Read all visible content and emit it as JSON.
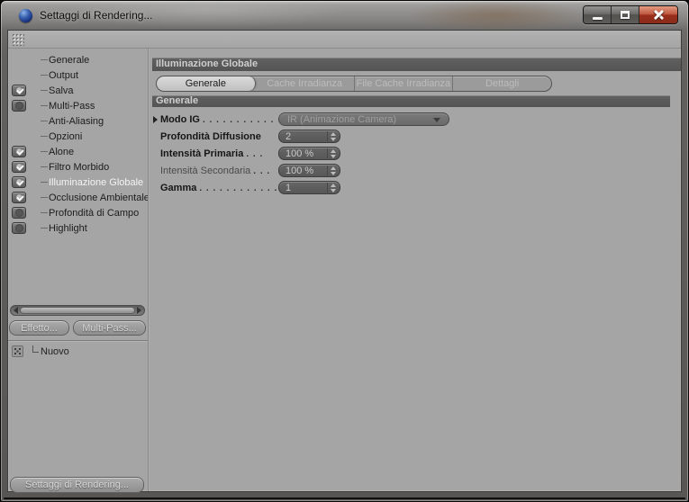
{
  "window": {
    "title": "Settaggi di Rendering...",
    "icons": {
      "app": "c4d-sphere-icon",
      "minimize": "minimize-icon",
      "maximize": "maximize-icon",
      "close": "close-icon"
    }
  },
  "toolbar": {
    "grip": "grip-dots-icon"
  },
  "sidebar": {
    "items": [
      {
        "label": "Generale",
        "enabled": null,
        "selected": false
      },
      {
        "label": "Output",
        "enabled": null,
        "selected": false
      },
      {
        "label": "Salva",
        "enabled": true,
        "selected": false
      },
      {
        "label": "Multi-Pass",
        "enabled": false,
        "selected": false
      },
      {
        "label": "Anti-Aliasing",
        "enabled": null,
        "selected": false
      },
      {
        "label": "Opzioni",
        "enabled": null,
        "selected": false
      },
      {
        "label": "Alone",
        "enabled": true,
        "selected": false
      },
      {
        "label": "Filtro Morbido",
        "enabled": true,
        "selected": false
      },
      {
        "label": "Illuminazione Globale",
        "enabled": true,
        "selected": true
      },
      {
        "label": "Occlusione Ambientale",
        "enabled": true,
        "selected": false
      },
      {
        "label": "Profondità di Campo",
        "enabled": false,
        "selected": false
      },
      {
        "label": "Highlight",
        "enabled": false,
        "selected": false
      }
    ],
    "effect_button": "Effetto...",
    "multipass_button": "Multi-Pass...",
    "presets": [
      {
        "label": "Nuovo"
      }
    ],
    "render_settings_button": "Settaggi di Rendering..."
  },
  "main": {
    "header": "Illuminazione Globale",
    "tabs": [
      {
        "label": "Generale",
        "active": true
      },
      {
        "label": "Cache Irradianza",
        "active": false
      },
      {
        "label": "File Cache Irradianza",
        "active": false
      },
      {
        "label": "Dettagli",
        "active": false
      }
    ],
    "section": "Generale",
    "fields": [
      {
        "label": "Modo IG",
        "dots": ". . . . . . . . . . .",
        "value": "IR (Animazione Camera)",
        "dim": false
      },
      {
        "label": "Profondità Diffusione",
        "dots": "",
        "value": "2",
        "dim": false
      },
      {
        "label": "Intensità Primaria",
        "dots": ". . .",
        "value": "100 %",
        "dim": false
      },
      {
        "label": "Intensità Secondaria",
        "dots": ". . .",
        "value": "100 %",
        "dim": true
      },
      {
        "label": "Gamma",
        "dots": ". . . . . . . . . . . .",
        "value": "1",
        "dim": false
      }
    ]
  },
  "colors": {
    "panel_bg": "#a5a5a5",
    "bar_bg": "#575757",
    "bar_text": "#cecece",
    "field_bg": "#5d5d5d",
    "field_text": "#c9c9c9",
    "active_tab_bg": "#cccccc",
    "selected_item_text": "#f4f4f4",
    "close_button": "#9a2f1c",
    "app_icon_blue": "#2a4f9a"
  }
}
